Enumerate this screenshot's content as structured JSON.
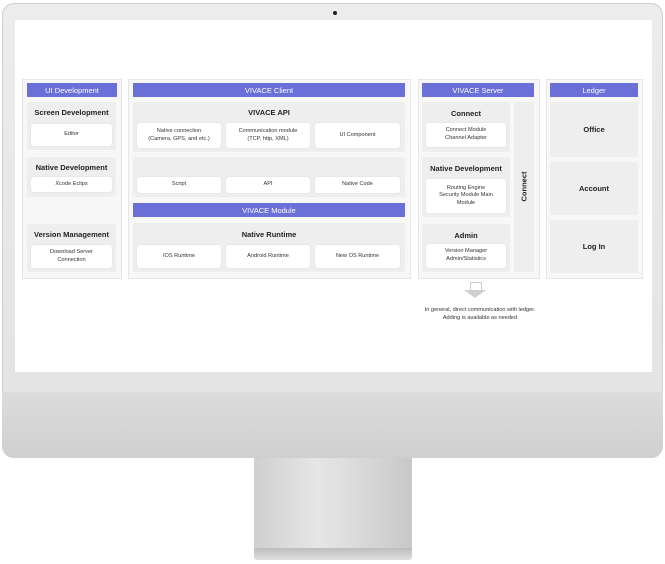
{
  "ui_development": {
    "header": "UI Development",
    "screen_dev": {
      "title": "Screen Development",
      "items": [
        "Editor"
      ]
    },
    "native_dev": {
      "title": "Native Development",
      "items": [
        "Xcode Eclips"
      ]
    },
    "version_mgmt": {
      "title": "Version Management",
      "items": [
        "Download Server\nConnection"
      ]
    }
  },
  "vivace_client": {
    "header": "VIVACE Client",
    "api": {
      "title": "VIVACE API",
      "items": [
        "Native connection\n(Camera, GPS, and etc.)",
        "Communication module\n(TCP, http, XML)",
        "UI Component"
      ]
    },
    "middle": {
      "items": [
        "Script",
        "API",
        "Native Code"
      ]
    },
    "module_header": "VIVACE Module",
    "runtime": {
      "title": "Native Runtime",
      "items": [
        "IOS Runtime",
        "Android Runtime",
        "New OS Runtime"
      ]
    }
  },
  "vivace_server": {
    "header": "VIVACE Server",
    "connect": {
      "title": "Connect",
      "items": [
        "Connect Module\nChannel Adapter"
      ]
    },
    "native_dev": {
      "title": "Native Development",
      "items": [
        "Routing Engine\nSecurity Module Main\nModule"
      ]
    },
    "admin": {
      "title": "Admin",
      "items": [
        "Version Manager\nAdmin/Statistics"
      ]
    },
    "side_label": "Connect"
  },
  "ledger": {
    "header": "Ledger",
    "items": [
      "Office",
      "Account",
      "Log In"
    ]
  },
  "note": "In general, direct communication with ledger.\nAdding is available as needed",
  "colors": {
    "header": "#6b6fd8",
    "panel": "#eeeeee"
  }
}
